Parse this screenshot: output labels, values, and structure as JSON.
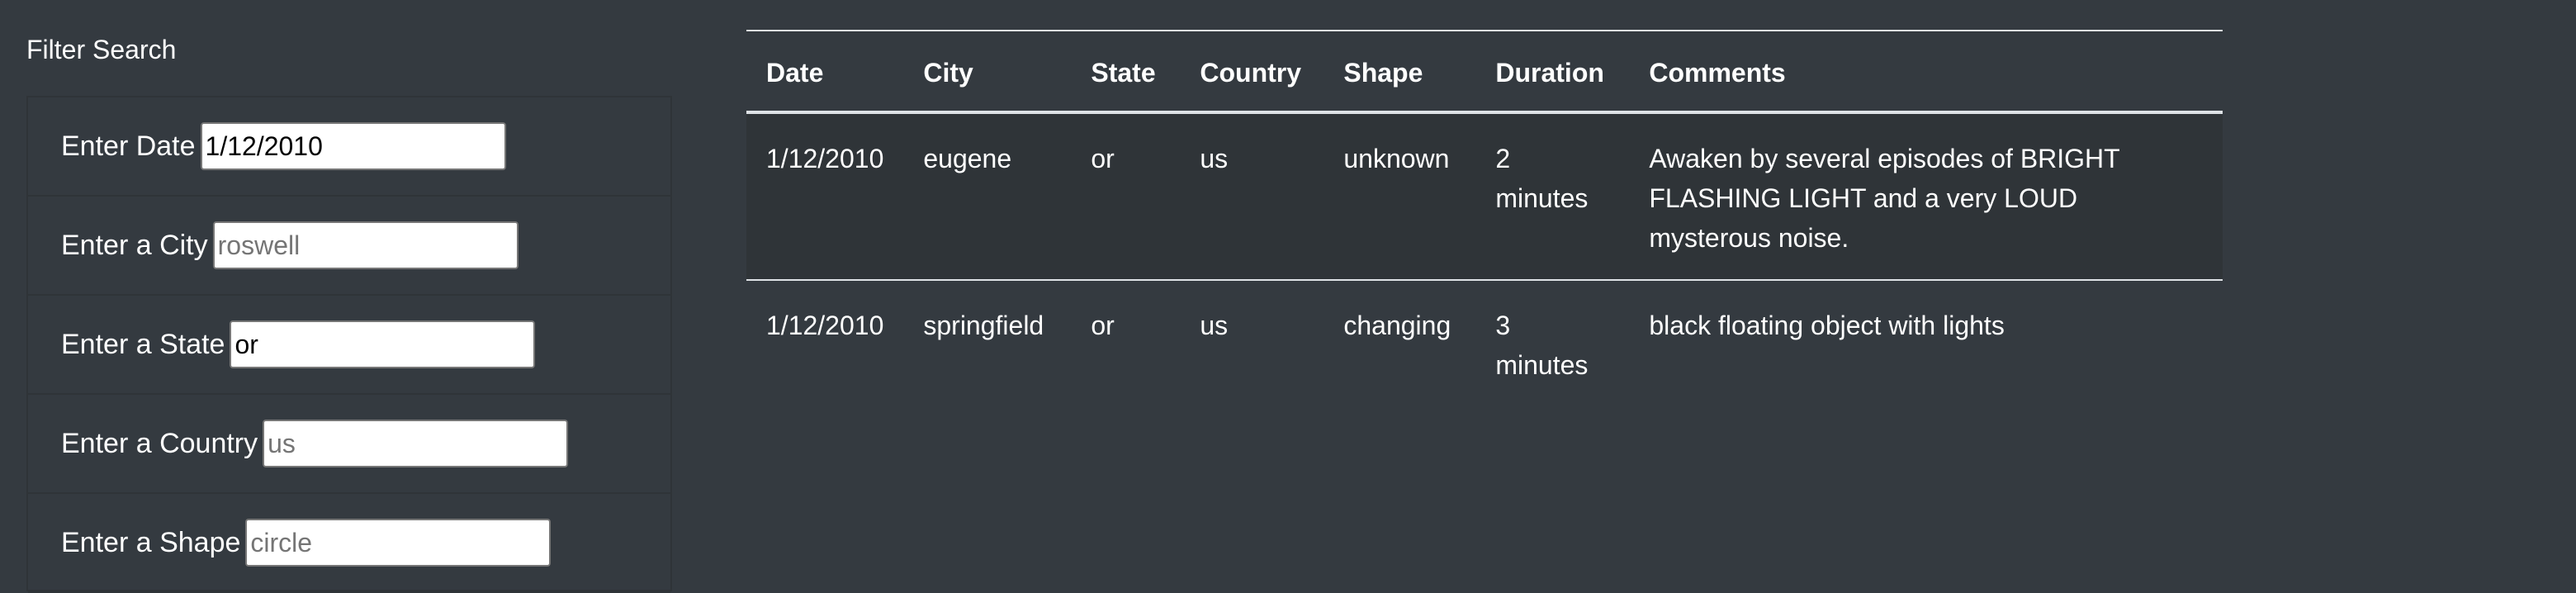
{
  "filter": {
    "title": "Filter Search",
    "fields": [
      {
        "label": "Enter Date",
        "value": "1/12/2010",
        "placeholder": ""
      },
      {
        "label": "Enter a City",
        "value": "",
        "placeholder": "roswell"
      },
      {
        "label": "Enter a State",
        "value": "or",
        "placeholder": ""
      },
      {
        "label": "Enter a Country",
        "value": "",
        "placeholder": "us"
      },
      {
        "label": "Enter a Shape",
        "value": "",
        "placeholder": "circle"
      }
    ]
  },
  "table": {
    "headers": [
      "Date",
      "City",
      "State",
      "Country",
      "Shape",
      "Duration",
      "Comments"
    ],
    "rows": [
      [
        "1/12/2010",
        "eugene",
        "or",
        "us",
        "unknown",
        "2 minutes",
        "Awaken by several episodes of BRIGHT FLASHING LIGHT and a very LOUD mysterous noise."
      ],
      [
        "1/12/2010",
        "springfield",
        "or",
        "us",
        "changing",
        "3 minutes",
        "black floating object with lights"
      ]
    ]
  },
  "colors": {
    "background": "#343a40",
    "stripe": "#2f3438",
    "border": "#dee2e6",
    "text": "#ffffff"
  }
}
